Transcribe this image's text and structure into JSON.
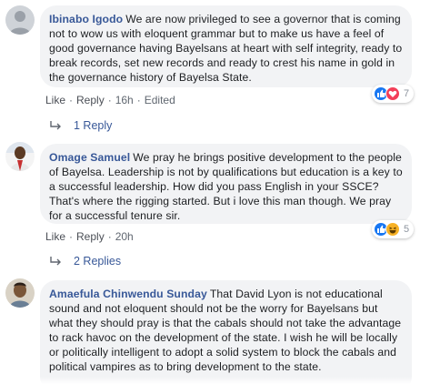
{
  "comments": [
    {
      "author": "Ibinabo Igodo",
      "text": "We are now privileged to see a governor that is coming not to wow us with eloquent grammar but to make us have a feel of good governance having Bayelsans at heart with self integrity, ready to break records, set new records and ready to crest his name in gold in the governance history of Bayelsa State.",
      "actions": {
        "like": "Like",
        "reply": "Reply",
        "time": "16h",
        "edited": "Edited"
      },
      "reactions": {
        "icons": [
          "like-icon",
          "love-icon"
        ],
        "count": "7"
      },
      "replies_label": "1 Reply"
    },
    {
      "author": "Omage Samuel",
      "text": "We pray he brings positive development to the people of Bayelsa. Leadership is not by qualifications but education is a key to a successful leadership. How did you pass English in your SSCE? That's where the rigging started. But i love this man though. We pray for a successful tenure sir.",
      "actions": {
        "like": "Like",
        "reply": "Reply",
        "time": "20h"
      },
      "reactions": {
        "icons": [
          "like-icon",
          "haha-icon"
        ],
        "count": "5"
      },
      "replies_label": "2 Replies"
    },
    {
      "author": "Amaefula Chinwendu Sunday",
      "text": "That David Lyon is not educational sound and not eloquent should not be the worry for Bayelsans but what they should pray is that the cabals should not take the advantage to rack havoc on the development of the state. I wish he will be locally or politically intelligent to adopt a solid system to block the cabals and political vampires as to bring development to the state."
    }
  ],
  "colors": {
    "author": "#385898",
    "bubble": "#f2f3f5",
    "like": "#1877f2",
    "love": "#f33e58",
    "haha": "#f7b125"
  }
}
